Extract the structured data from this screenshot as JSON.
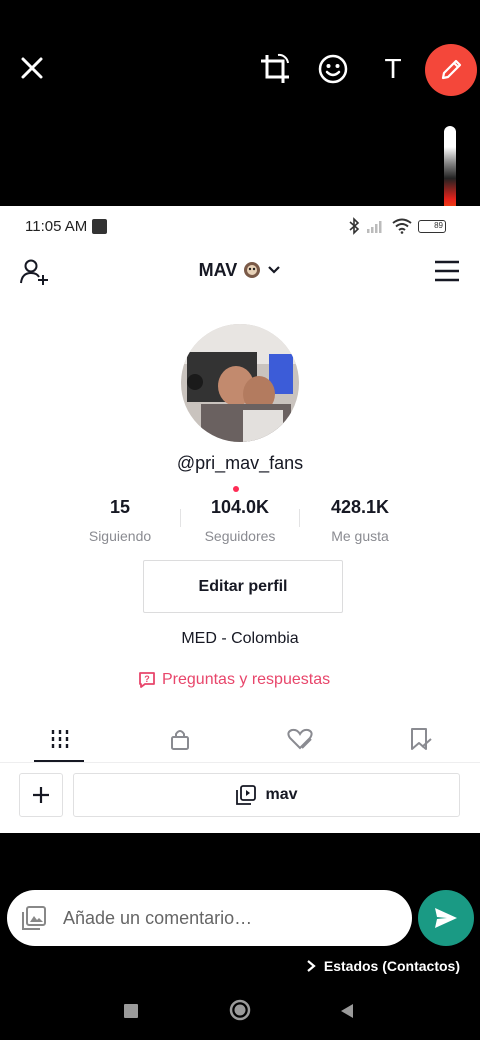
{
  "editor": {
    "tools": [
      "close-icon",
      "crop-icon",
      "emoji-icon",
      "text-tool",
      "pen-icon"
    ],
    "text_tool_label": "T",
    "active_tool_color": "#f4473a"
  },
  "status_bar": {
    "time": "11:05 AM",
    "battery": "89"
  },
  "profile": {
    "title": "MAV",
    "handle": "@pri_mav_fans",
    "stats": [
      {
        "value": "15",
        "label": "Siguiendo"
      },
      {
        "value": "104.0K",
        "label": "Seguidores"
      },
      {
        "value": "428.1K",
        "label": "Me gusta"
      }
    ],
    "edit_button": "Editar perfil",
    "bio": "MED - Colombia",
    "qa_link": "Preguntas y respuestas",
    "playlist_label": "mav"
  },
  "comment": {
    "placeholder": "Añade un comentario…"
  },
  "destination": {
    "label": "Estados (Contactos)"
  },
  "colors": {
    "accent_pink": "#fe2c55",
    "send_green": "#1a9a84"
  }
}
